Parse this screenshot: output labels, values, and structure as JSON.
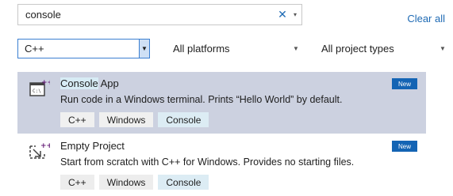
{
  "search": {
    "value": "console",
    "clear_glyph": "✕",
    "dropdown_glyph": "▾"
  },
  "clear_all_label": "Clear all",
  "filters": {
    "language": "C++",
    "platform": "All platforms",
    "project_type": "All project types"
  },
  "templates": [
    {
      "title_highlight": "Console",
      "title_rest": " App",
      "description": "Run code in a Windows terminal. Prints “Hello World” by default.",
      "badge": "New",
      "tags": [
        "C++",
        "Windows",
        "Console"
      ],
      "icon": "console-app-icon",
      "selected": true
    },
    {
      "title_highlight": "",
      "title_rest": "Empty Project",
      "description": "Start from scratch with C++ for Windows. Provides no starting files.",
      "badge": "New",
      "tags": [
        "C++",
        "Windows",
        "Console"
      ],
      "icon": "empty-project-icon",
      "selected": false
    }
  ],
  "colors": {
    "accent": "#1e6ab4",
    "selected_row": "#ccd1e0",
    "badge": "#1464b4",
    "icon_plus": "#68217a"
  }
}
